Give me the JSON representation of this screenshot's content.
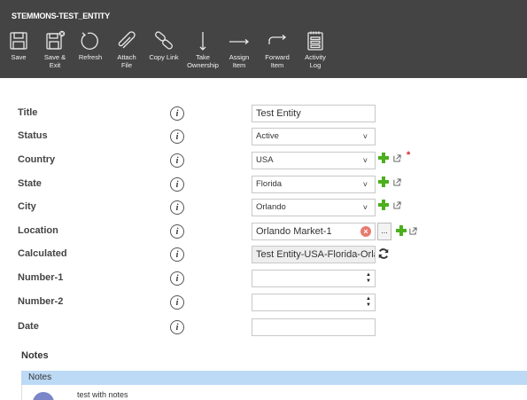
{
  "window": {
    "title": "STEMMONS-TEST_ENTITY"
  },
  "toolbar": {
    "buttons": [
      {
        "id": "save",
        "label": "Save",
        "icon": "save-icon"
      },
      {
        "id": "save-exit",
        "label": "Save &\nExit",
        "icon": "save-exit-icon"
      },
      {
        "id": "refresh",
        "label": "Refresh",
        "icon": "refresh-icon"
      },
      {
        "id": "attach",
        "label": "Attach\nFile",
        "icon": "paperclip-icon"
      },
      {
        "id": "copy-link",
        "label": "Copy Link",
        "icon": "link-icon"
      },
      {
        "id": "take-ownership",
        "label": "Take\nOwnership",
        "icon": "arrow-down-icon"
      },
      {
        "id": "assign",
        "label": "Assign\nItem",
        "icon": "arrow-right-icon"
      },
      {
        "id": "forward",
        "label": "Forward\nItem",
        "icon": "forward-arrow-icon"
      },
      {
        "id": "activity-log",
        "label": "Activity\nLog",
        "icon": "log-icon"
      }
    ]
  },
  "form": {
    "info_glyph": "i",
    "required_marker": "*",
    "chevron": "˅",
    "fields": {
      "title": {
        "label": "Title",
        "value": "Test Entity"
      },
      "status": {
        "label": "Status",
        "value": "Active"
      },
      "country": {
        "label": "Country",
        "value": "USA"
      },
      "state": {
        "label": "State",
        "value": "Florida"
      },
      "city": {
        "label": "City",
        "value": "Orlando"
      },
      "location": {
        "label": "Location",
        "value": "Orlando Market-1",
        "browse_label": "..."
      },
      "calculated": {
        "label": "Calculated",
        "value": "Test Entity-USA-Florida-Orlando"
      },
      "number1": {
        "label": "Number-1",
        "value": ""
      },
      "number2": {
        "label": "Number-2",
        "value": ""
      },
      "date": {
        "label": "Date",
        "value": ""
      }
    }
  },
  "notes": {
    "heading": "Notes",
    "table_header": "Notes",
    "items": [
      {
        "text": "test with notes"
      }
    ]
  },
  "colors": {
    "toolbar_bg": "#444444",
    "notes_header_bg": "#bcd9f5",
    "add_green": "#4caf1e",
    "required_red": "#d12a2a"
  }
}
